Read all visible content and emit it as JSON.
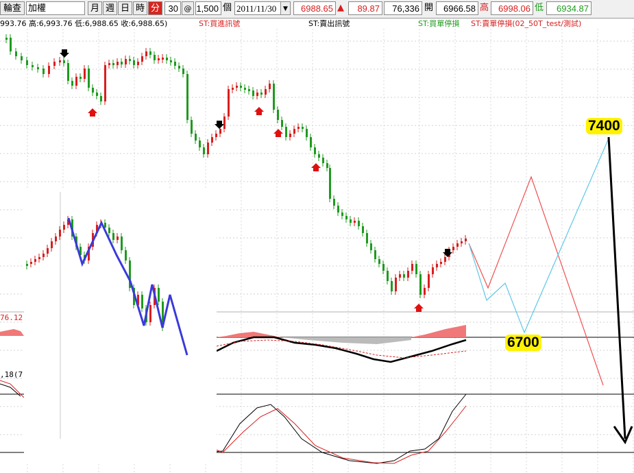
{
  "toolbar": {
    "search_label": "輪查",
    "symbol": "加權",
    "periods": [
      "月",
      "週",
      "日",
      "時",
      "分"
    ],
    "active_period": "分",
    "interval": "30",
    "at_symbol": "@",
    "count": "1,500",
    "count_unit": "個",
    "date": "2011/11/30",
    "last": "6988.65",
    "change_arrow": "▲",
    "change": "89.87",
    "volume": "76,336",
    "open_label": "開",
    "open": "6966.58",
    "high_label": "高",
    "high": "6998.06",
    "low_label": "低",
    "low": "6934.87"
  },
  "info": {
    "ohlc": "993.76 高:6,993.76 低:6,988.65 收:6,988.65)",
    "buy_signal": "ST:買進訊號",
    "sell_signal": "ST:賣出訊號",
    "buy_stop": "ST:買單停損",
    "sell_stop": "ST:賣單停損(02_50T_test/測試)"
  },
  "colors": {
    "up": "#d81e1e",
    "down": "#1e9a1e",
    "projection_red": "#f05050",
    "projection_cyan": "#5cc8e8",
    "highlight": "#fff200"
  },
  "annotations": {
    "target_high": "7400",
    "target_low": "6700"
  },
  "indicator_labels": {
    "volume_value": "76.12",
    "kd_params": ",18(7"
  },
  "icons": [
    "buy-arrow-icon",
    "sell-arrow-icon",
    "dropdown-arrow-icon",
    "up-triangle-icon"
  ]
}
